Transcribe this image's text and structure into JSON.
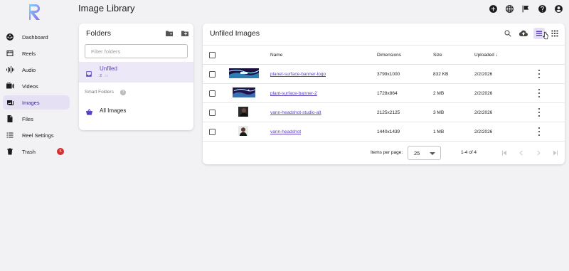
{
  "app": {
    "page_title": "Image Library"
  },
  "sidebar": {
    "items": [
      {
        "label": "Dashboard",
        "icon": "dashboard-icon"
      },
      {
        "label": "Reels",
        "icon": "reels-icon"
      },
      {
        "label": "Audio",
        "icon": "audio-icon"
      },
      {
        "label": "Videos",
        "icon": "videos-icon"
      },
      {
        "label": "Images",
        "icon": "images-icon",
        "active": true
      },
      {
        "label": "Files",
        "icon": "files-icon"
      },
      {
        "label": "Reel Settings",
        "icon": "reel-settings-icon"
      },
      {
        "label": "Trash",
        "icon": "trash-icon",
        "badge": "5"
      }
    ]
  },
  "header_icons": [
    "add-circle-icon",
    "language-icon",
    "announcement-icon",
    "help-icon",
    "account-icon"
  ],
  "folders": {
    "title": "Folders",
    "filter_placeholder": "Filter folders",
    "selected_folder": {
      "name": "Unfiled",
      "count": "2"
    },
    "smart_folders_label": "Smart Folders",
    "smart_folder": {
      "name": "All Images"
    }
  },
  "images": {
    "title": "Unfiled Images",
    "columns": {
      "name": "Name",
      "dimensions": "Dimensions",
      "size": "Size",
      "uploaded": "Uploaded"
    },
    "rows": [
      {
        "name": "planet-surface-banner-logo",
        "dimensions": "3799x1000",
        "size": "832 KB",
        "uploaded": "2/2/2026"
      },
      {
        "name": "plant-surface-banner-2",
        "dimensions": "1728x864",
        "size": "2 MB",
        "uploaded": "2/2/2026"
      },
      {
        "name": "vann-headshot-studio-alt",
        "dimensions": "2125x2125",
        "size": "3 MB",
        "uploaded": "2/2/2026"
      },
      {
        "name": "vann-headshot",
        "dimensions": "1440x1439",
        "size": "1 MB",
        "uploaded": "2/2/2026"
      }
    ],
    "footer": {
      "items_per_page_label": "Items per page:",
      "items_per_page_value": "25",
      "range": "1-4 of 4"
    }
  },
  "colors": {
    "accent": "#5a3fc0",
    "active_bg": "#e6e0f5",
    "badge": "#d32f2f",
    "background": "#f2f1f3"
  }
}
